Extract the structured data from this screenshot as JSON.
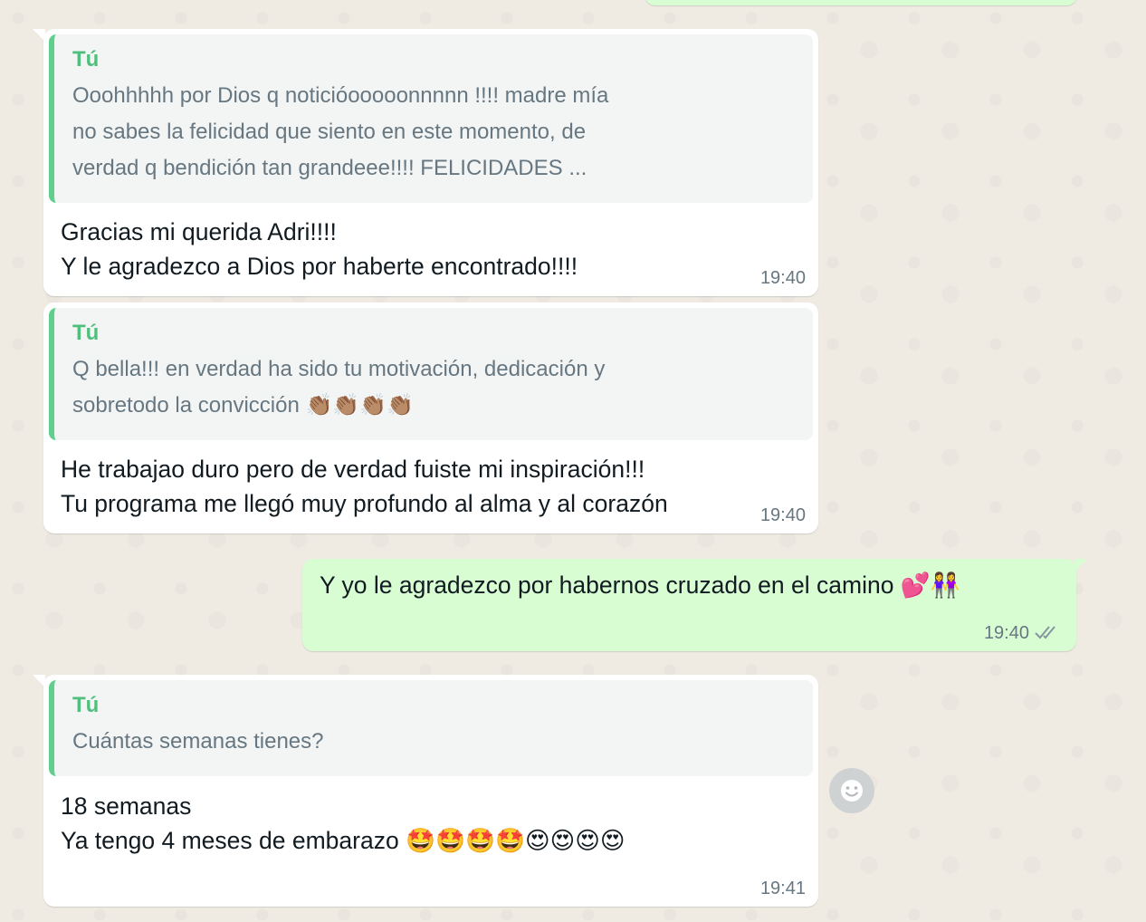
{
  "messages": [
    {
      "direction": "incoming",
      "quote_author": "Tú",
      "quote_text": "Ooohhhhh por Dios q noticióooooonnnnn !!!! madre mía\nno sabes la felicidad que siento en este momento, de\nverdad q bendición tan grandeee!!!! FELICIDADES ...",
      "text": "Gracias mi querida Adri!!!!\nY le agradezco a Dios por haberte encontrado!!!!",
      "time": "19:40"
    },
    {
      "direction": "incoming",
      "quote_author": "Tú",
      "quote_text": "Q bella!!! en verdad ha sido tu motivación, dedicación y\nsobretodo la convicción 👏🏽👏🏽👏🏽👏🏽",
      "text": "He trabajao duro pero de verdad fuiste mi inspiración!!!\nTu programa me llegó muy profundo al alma y al corazón",
      "time": "19:40"
    },
    {
      "direction": "outgoing",
      "text": "Y yo le agradezco por habernos cruzado en el camino 💕👭",
      "time": "19:40",
      "status_icon": "double-check-icon"
    },
    {
      "direction": "incoming",
      "quote_author": "Tú",
      "quote_text": "Cuántas semanas tienes?",
      "text": "18 semanas\nYa tengo 4 meses de embarazo 🤩🤩🤩🤩😍😍😍😍",
      "time": "19:41"
    }
  ],
  "reaction_button_icon": "smiley-face-icon",
  "colors": {
    "background": "#efeae2",
    "incoming_bubble": "#ffffff",
    "outgoing_bubble": "#d9fdd3",
    "quote_accent": "#5fcf8c",
    "quote_author": "#4fbf7e",
    "timestamp": "#667781"
  }
}
